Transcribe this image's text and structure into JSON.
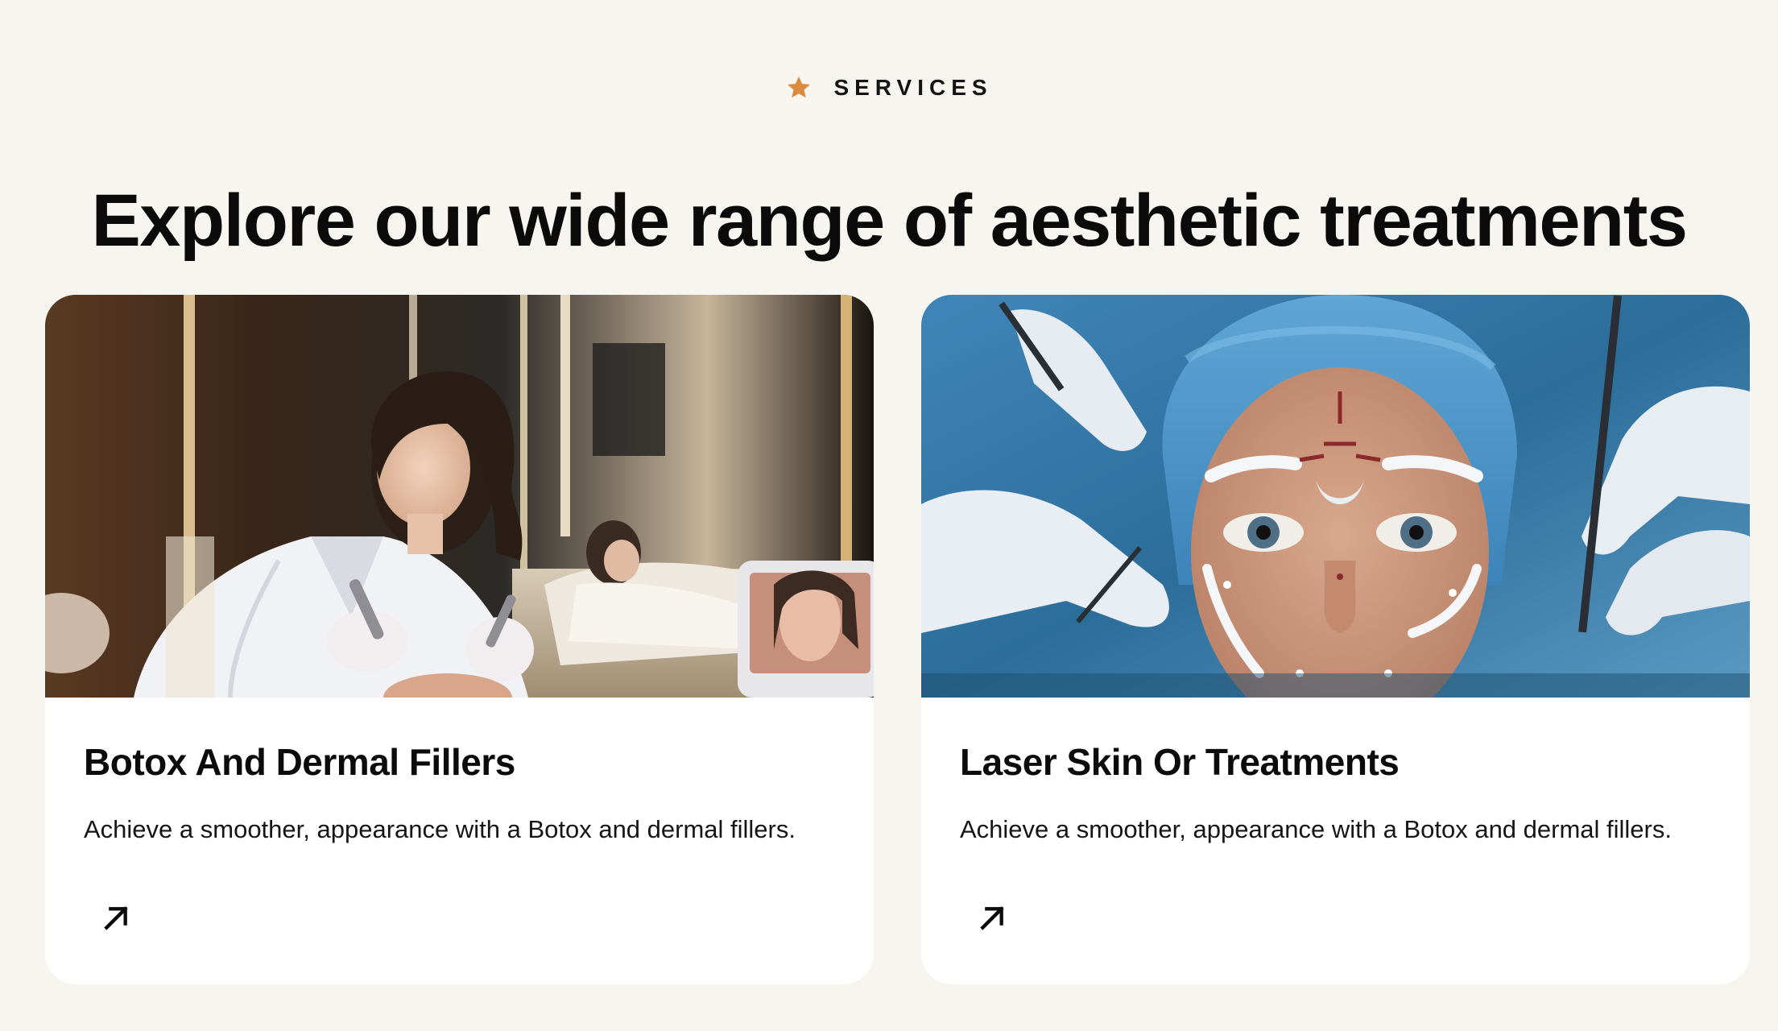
{
  "section": {
    "eyebrow": "SERVICES",
    "eyebrow_icon": "star-icon",
    "accent_color": "#d98a3d",
    "heading": "Explore our wide range of aesthetic treatments"
  },
  "cards": [
    {
      "title": "Botox And Dermal Fillers",
      "description": "Achieve a smoother, appearance with a Botox and dermal fillers.",
      "image": "clinic-practitioner-photo",
      "link_icon": "arrow-up-right-icon"
    },
    {
      "title": "Laser Skin Or Treatments",
      "description": "Achieve a smoother, appearance with a Botox and dermal fillers.",
      "image": "facial-procedure-photo",
      "link_icon": "arrow-up-right-icon"
    }
  ]
}
